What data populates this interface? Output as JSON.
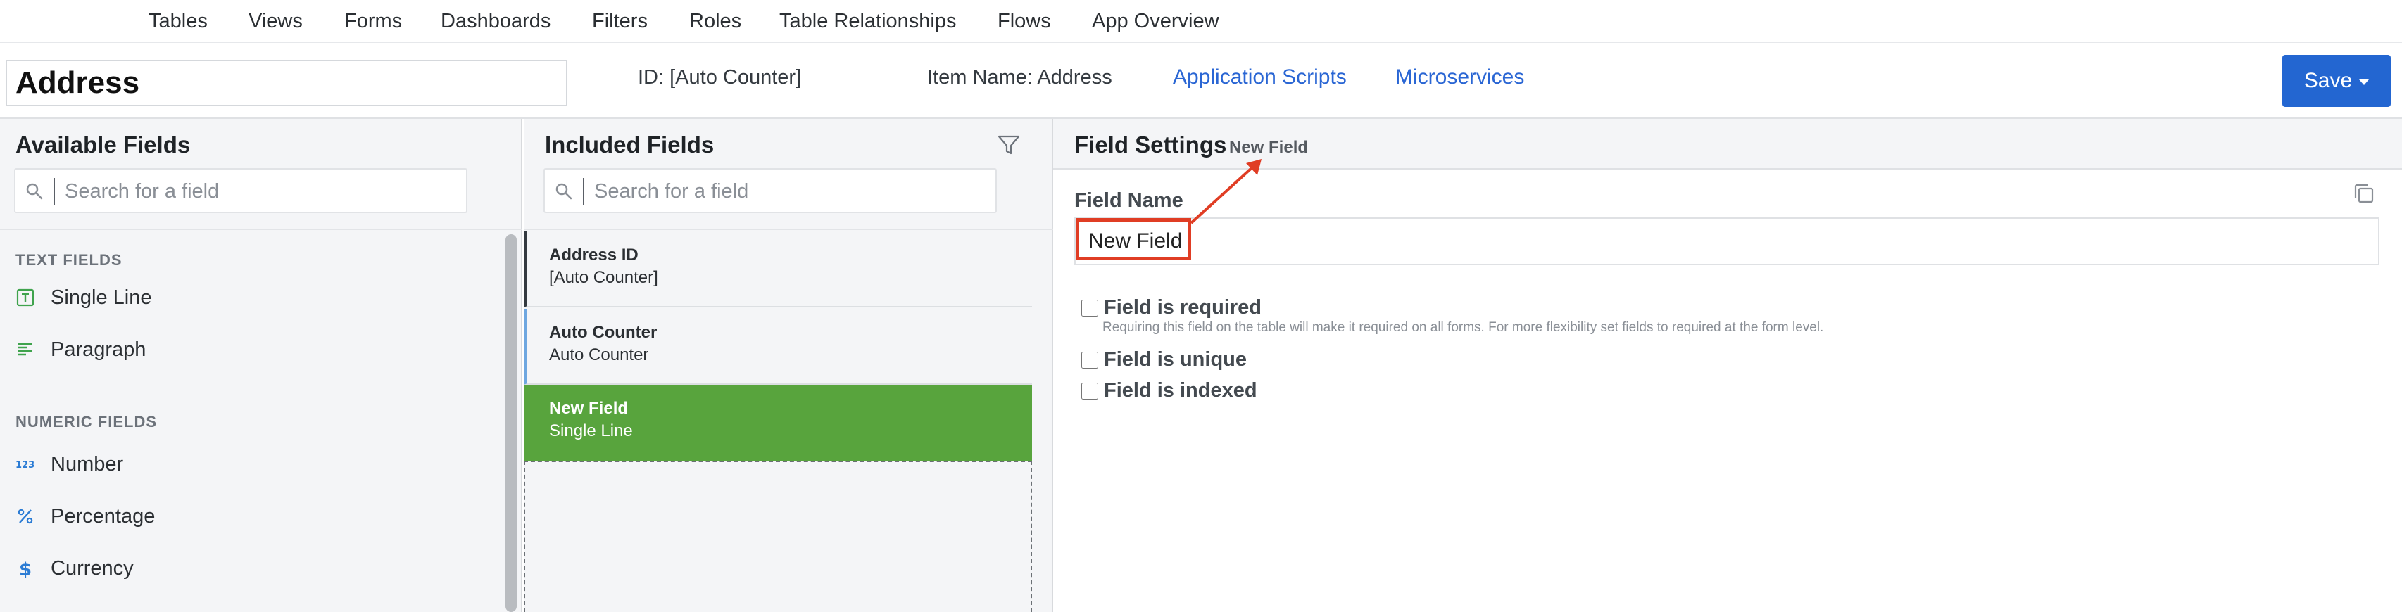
{
  "nav": {
    "items": [
      "Tables",
      "Views",
      "Forms",
      "Dashboards",
      "Filters",
      "Roles",
      "Table Relationships",
      "Flows",
      "App Overview"
    ]
  },
  "header": {
    "title": "Address",
    "id_label": "ID: [Auto Counter]",
    "item_name_label": "Item Name: Address",
    "links": [
      "Application Scripts",
      "Microservices"
    ],
    "save_label": "Save"
  },
  "available": {
    "title": "Available Fields",
    "search_placeholder": "Search for a field",
    "sections": [
      {
        "label": "TEXT FIELDS",
        "items": [
          {
            "label": "Single Line",
            "icon": "text-t-icon"
          },
          {
            "label": "Paragraph",
            "icon": "paragraph-lines-icon"
          }
        ]
      },
      {
        "label": "NUMERIC FIELDS",
        "items": [
          {
            "label": "Number",
            "icon": "number-123-icon"
          },
          {
            "label": "Percentage",
            "icon": "percent-icon"
          },
          {
            "label": "Currency",
            "icon": "dollar-icon"
          }
        ]
      }
    ]
  },
  "included": {
    "title": "Included Fields",
    "search_placeholder": "Search for a field",
    "fields": [
      {
        "name": "Address ID",
        "type": "[Auto Counter]"
      },
      {
        "name": "Auto Counter",
        "type": "Auto Counter"
      },
      {
        "name": "New Field",
        "type": "Single Line",
        "selected": true
      }
    ]
  },
  "settings": {
    "title": "Field Settings",
    "subtitle": "New Field",
    "field_name_label": "Field Name",
    "field_name_value": "New Field",
    "checkboxes": [
      {
        "label": "Field is required",
        "checked": false,
        "help": "Requiring this field on the table will make it required on all forms. For more flexibility set fields to required at the form level."
      },
      {
        "label": "Field is unique",
        "checked": false
      },
      {
        "label": "Field is indexed",
        "checked": false
      }
    ]
  },
  "colors": {
    "accent": "#2366d1",
    "link": "#2a66d4",
    "selected_green": "#58a43d",
    "annotation_red": "#e03d24"
  }
}
